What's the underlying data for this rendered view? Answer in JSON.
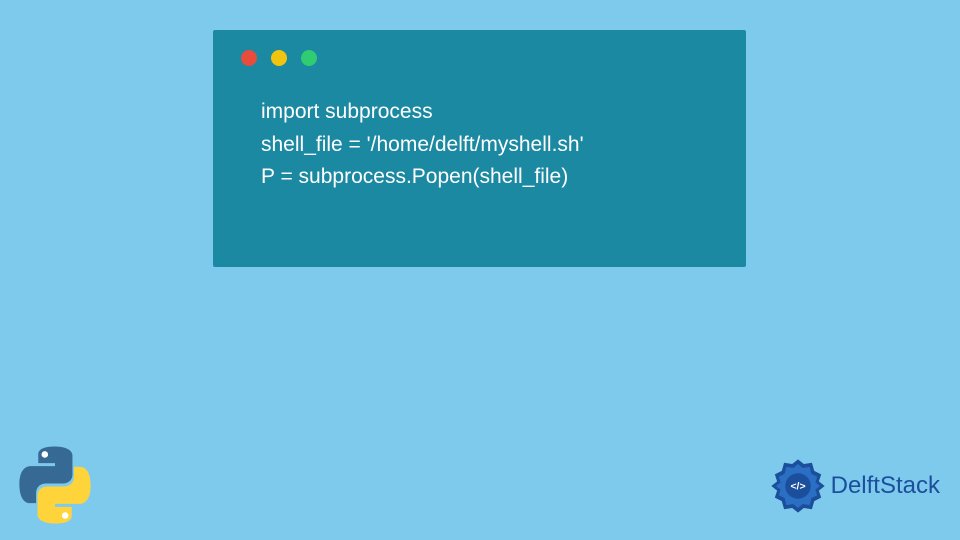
{
  "code": {
    "line1": "import subprocess",
    "line2": "shell_file = '/home/delft/myshell.sh'",
    "line3": "P = subprocess.Popen(shell_file)"
  },
  "brand": {
    "name": "DelftStack"
  },
  "colors": {
    "background": "#7ecaed",
    "codeWindow": "#1b89a1",
    "dotRed": "#e84c3d",
    "dotYellow": "#f1c40f",
    "dotGreen": "#2fcc71",
    "brandBlue": "#1b4f9c",
    "pythonBlue": "#366994",
    "pythonYellow": "#ffd43b"
  }
}
